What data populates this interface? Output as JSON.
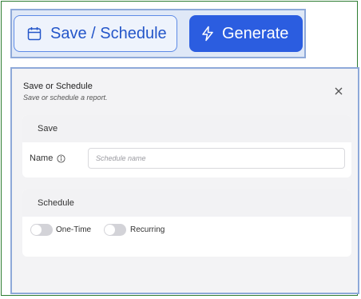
{
  "toolbar": {
    "save_schedule_label": "Save / Schedule",
    "generate_label": "Generate"
  },
  "dialog": {
    "title": "Save or Schedule",
    "subtitle": "Save or schedule a report.",
    "save_section": {
      "header": "Save",
      "name_label": "Name",
      "name_placeholder": "Schedule name",
      "name_value": ""
    },
    "schedule_section": {
      "header": "Schedule",
      "one_time_label": "One-Time",
      "one_time_on": false,
      "recurring_label": "Recurring",
      "recurring_on": false
    }
  },
  "colors": {
    "accent": "#2b5de0",
    "frame_highlight": "#8ea9d9",
    "outer_border": "#2e7d32"
  }
}
